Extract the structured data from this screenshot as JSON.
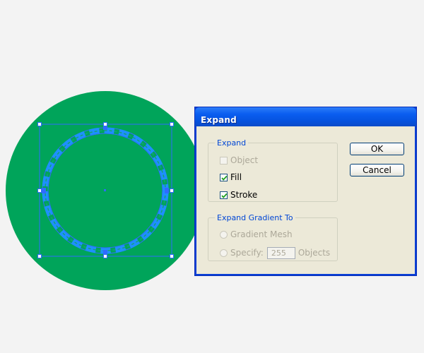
{
  "colors": {
    "canvas_bg": "#f3f3f3",
    "shape_fill": "#00a45a",
    "selection": "#2f6bff",
    "stroke_dash": "#1e90ff",
    "dialog_face": "#ece9d8",
    "titlebar": "#0a5ef0",
    "group_label": "#0046d5"
  },
  "dialog": {
    "title": "Expand",
    "expand_group": {
      "legend": "Expand",
      "object": {
        "label": "Object",
        "checked": false,
        "enabled": false
      },
      "fill": {
        "label": "Fill",
        "checked": true,
        "enabled": true
      },
      "stroke": {
        "label": "Stroke",
        "checked": true,
        "enabled": true
      }
    },
    "gradient_group": {
      "legend": "Expand Gradient To",
      "gradient_mesh": {
        "label": "Gradient Mesh",
        "enabled": false
      },
      "specify": {
        "label": "Specify:",
        "value": "255",
        "suffix": "Objects",
        "enabled": false
      }
    },
    "ok_label": "OK",
    "cancel_label": "Cancel"
  },
  "icons": {
    "checkbox_checked": "check-mark-icon",
    "center_point": "center-point-icon"
  }
}
